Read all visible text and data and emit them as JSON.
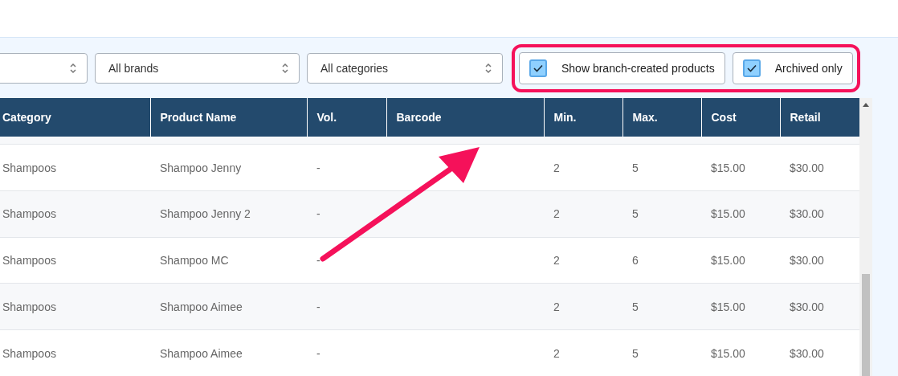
{
  "filters": [
    {
      "value": "All brands"
    },
    {
      "value": "All categories"
    }
  ],
  "toggles": [
    {
      "label": "Show branch-created products",
      "checked": true
    },
    {
      "label": "Archived only",
      "checked": true
    }
  ],
  "table": {
    "columns": [
      "Category",
      "Product Name",
      "Vol.",
      "Barcode",
      "Min.",
      "Max.",
      "Cost",
      "Retail"
    ],
    "rows": [
      [
        "Shampoos",
        "Shampoo Jenny",
        "-",
        "",
        "2",
        "5",
        "$15.00",
        "$30.00"
      ],
      [
        "Shampoos",
        "Shampoo Jenny 2",
        "-",
        "",
        "2",
        "5",
        "$15.00",
        "$30.00"
      ],
      [
        "Shampoos",
        "Shampoo MC",
        "-",
        "",
        "2",
        "6",
        "$15.00",
        "$30.00"
      ],
      [
        "Shampoos",
        "Shampoo Aimee",
        "-",
        "",
        "2",
        "5",
        "$15.00",
        "$30.00"
      ],
      [
        "Shampoos",
        "Shampoo Aimee",
        "-",
        "",
        "2",
        "5",
        "$15.00",
        "$30.00"
      ]
    ]
  }
}
